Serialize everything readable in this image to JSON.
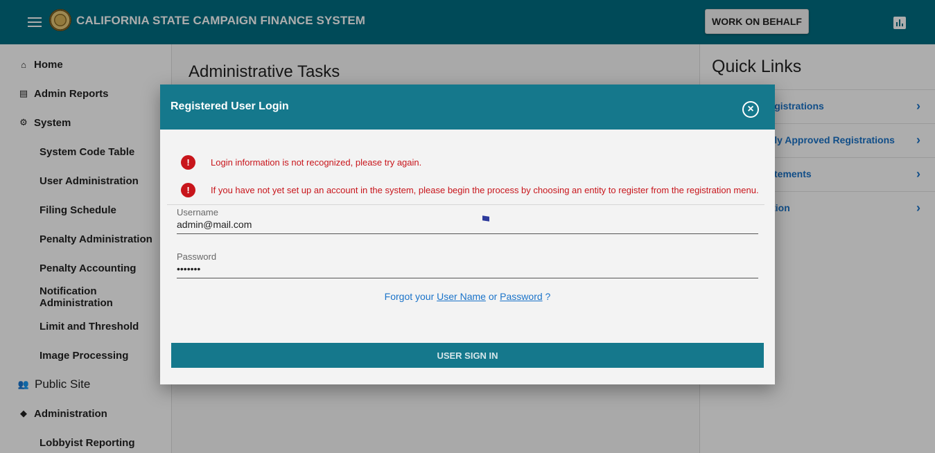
{
  "header": {
    "title": "CALIFORNIA STATE CAMPAIGN FINANCE SYSTEM",
    "work_on_behalf_label": "WORK ON BEHALF",
    "menu_icon": "hamburger-menu-icon",
    "logo": "state-seal",
    "report_icon": "bar-chart-icon",
    "brand_color": "#006e82"
  },
  "sidebar": {
    "items": [
      {
        "label": "Home",
        "icon": "home-icon"
      },
      {
        "label": "Admin Reports",
        "icon": "report-icon"
      },
      {
        "label": "System",
        "icon": "gear-icon"
      },
      {
        "label": "System Code Table"
      },
      {
        "label": "User Administration"
      },
      {
        "label": "Filing Schedule"
      },
      {
        "label": "Penalty Administration"
      },
      {
        "label": "Penalty Accounting"
      },
      {
        "label": "Notification Administration"
      },
      {
        "label": "Limit and Threshold"
      },
      {
        "label": "Image Processing"
      },
      {
        "label": "Public Site",
        "icon": "people-icon"
      },
      {
        "label": "Administration",
        "icon": "diamond-icon"
      },
      {
        "label": "Lobbyist Reporting"
      }
    ]
  },
  "main": {
    "title": "Administrative Tasks"
  },
  "quick_links": {
    "title": "Quick Links",
    "items": [
      {
        "label": "() Pending Registrations"
      },
      {
        "label": "() Conditionally Approved Registrations"
      },
      {
        "label": "View Late Statements"
      },
      {
        "label": "Add Registration"
      }
    ]
  },
  "modal": {
    "title": "Registered User Login",
    "close_icon": "close-circle-icon",
    "errors": [
      "Login information is not recognized, please try again.",
      "If you have not yet set up an account in the system, please begin the process by choosing an entity to register from the registration menu."
    ],
    "error_color": "#c8151b",
    "username": {
      "label": "Username",
      "value": "admin@mail.com"
    },
    "password": {
      "label": "Password",
      "value": "•••••••"
    },
    "forgot": {
      "prefix": "Forgot your",
      "username_link": "User Name",
      "or": "or",
      "password_link": "Password",
      "suffix": "?"
    },
    "signin_label": "USER SIGN IN"
  }
}
